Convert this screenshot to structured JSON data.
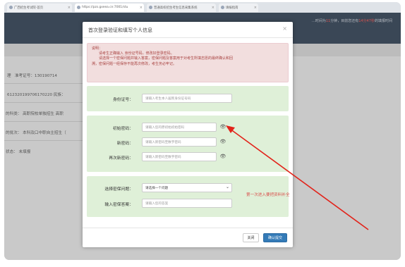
{
  "browser": {
    "tabs": [
      {
        "label": "广西招生考试院-首页"
      },
      {
        "label": "https://pzs.gxeea.cn:7001/stu"
      },
      {
        "label": "普通高校招生考生信息采集系统"
      },
      {
        "label": "填报指南"
      }
    ]
  },
  "site": {
    "notice_prefix": "…时间为",
    "notice_min": "11",
    "notice_mid": "分钟，目前您还有",
    "notice_count": "14分47秒",
    "notice_suffix": "的填报时间",
    "fields": [
      {
        "label": "理",
        "value": "准考证号：130190714"
      },
      {
        "label": "",
        "value": "6123201997061702​20   民族："
      },
      {
        "label": "",
        "value": "的科类：  高职院校单独招生 高职"
      },
      {
        "label": "",
        "value": "的批次：  本科及口中职自主招生（"
      },
      {
        "label": "",
        "value": "状态：  未填报"
      }
    ]
  },
  "modal": {
    "title": "首次登录验证和填写个人信息",
    "close_glyph": "×",
    "alert": {
      "heading": "说明：",
      "lines": [
        "请考生正确输入 身份证号码，修改好登录密码。",
        "请选择一个密保问题并输入答案，密保问题及答案用于对考生所填志愿的最终确认和回",
        "溯，密保问题一经保存不能再次修改，考生务必牢记。"
      ]
    },
    "id_section": {
      "label": "身份证号：",
      "placeholder": "请输入考生本人居民身份证号码"
    },
    "password_section": {
      "initial_label": "初始密码：",
      "initial_placeholder": "请输入您的原初始初始密码",
      "new_label": "新密码：",
      "new_placeholder": "请输入新密码至数字密码",
      "confirm_label": "再次新密码：",
      "confirm_placeholder": "请输入新密码至数字密码",
      "eye_glyph": "👁"
    },
    "security_section": {
      "question_label": "选择密保问题：",
      "question_value": "请选择一个问题",
      "answer_label": "输入密保答案：",
      "answer_placeholder": "请输入您的答案"
    },
    "buttons": {
      "close": "关闭",
      "confirm": "确认提交"
    }
  },
  "annotation": {
    "text": "第一次进入要把资料补全",
    "color": "#d9534f"
  }
}
